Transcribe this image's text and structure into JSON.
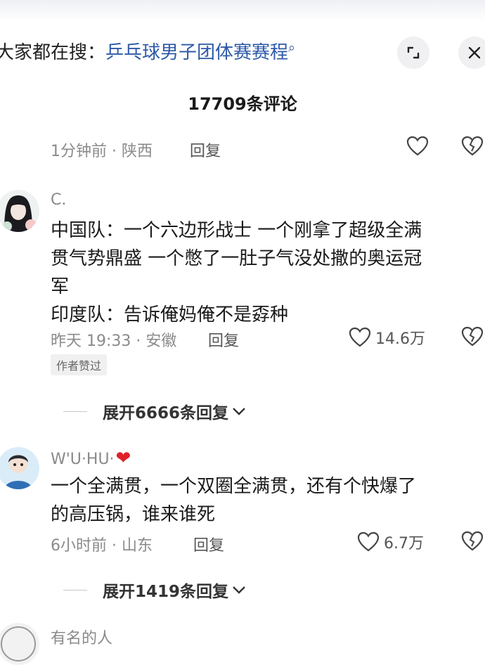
{
  "search_hint": {
    "prefix": "大家都在搜：",
    "term": "乒乓球男子团体赛赛程"
  },
  "comments_header": {
    "count_label": "17709条评论"
  },
  "comment0": {
    "time_location": "1分钟前 · 陕西",
    "reply": "回复"
  },
  "comment1": {
    "username": "C.",
    "lines": [
      "中国队：一个六边形战士 一个刚拿了超级全满",
      "贯气势鼎盛 一个憋了一肚子气没处撒的奥运冠",
      "军",
      "印度队：告诉俺妈俺不是孬种"
    ],
    "time_location": "昨天 19:33 · 安徽",
    "reply": "回复",
    "likes": "14.6万",
    "author_badge": "作者赞过",
    "expand": "展开6666条回复"
  },
  "comment2": {
    "username": "W'U·HU·",
    "lines": [
      "一个全满贯，一个双圈全满贯，还有个快爆了",
      "的高压锅，谁来谁死"
    ],
    "time_location": "6小时前 · 山东",
    "reply": "回复",
    "likes": "6.7万",
    "expand": "展开1419条回复"
  },
  "comment3": {
    "username": "有名的人"
  },
  "colors": {
    "link_blue": "#2d5aa8",
    "meta_gray": "#8a8a8a",
    "heart_red": "#e0212a"
  }
}
